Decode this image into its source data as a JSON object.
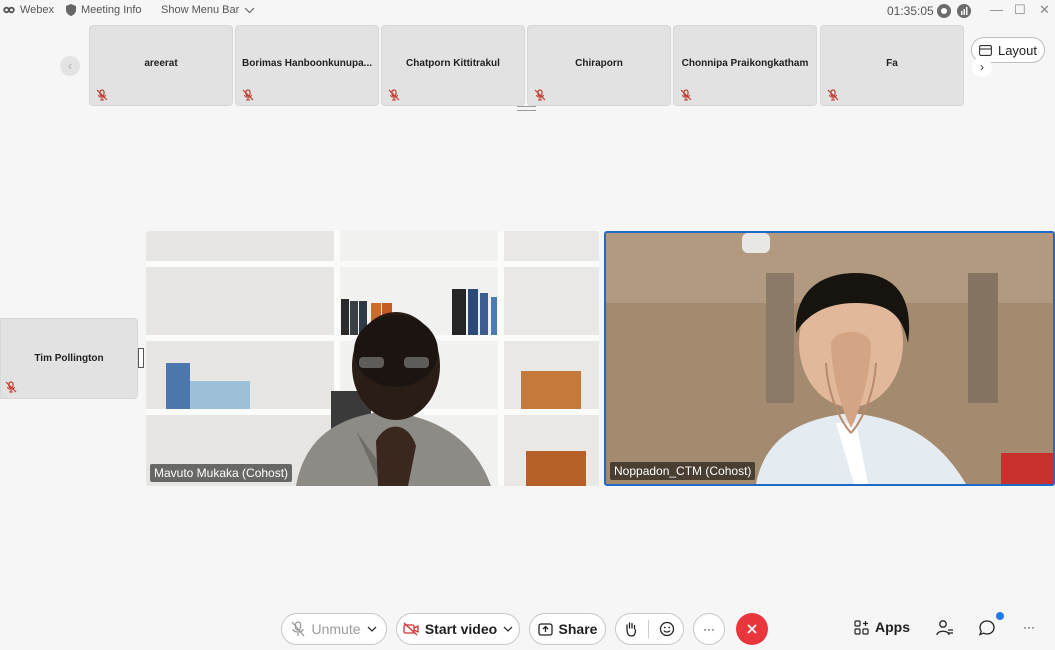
{
  "titlebar": {
    "app_name": "Webex",
    "meeting_info": "Meeting Info",
    "show_menu_bar": "Show Menu Bar",
    "elapsed_time": "01:35:05"
  },
  "participants_strip": [
    {
      "name": "areerat",
      "muted": true
    },
    {
      "name": "Borimas Hanboonkunupa...",
      "muted": true
    },
    {
      "name": "Chatporn Kittitrakul",
      "muted": true
    },
    {
      "name": "Chiraporn",
      "muted": true
    },
    {
      "name": "Chonnipa Praikongkatham",
      "muted": true
    },
    {
      "name": "Fa",
      "muted": true
    }
  ],
  "layout_button": {
    "label": "Layout",
    "icon": "layout-icon"
  },
  "side_participant": {
    "name": "Tim Pollington",
    "muted": true
  },
  "video_tiles": [
    {
      "name": "Mavuto Mukaka (Cohost)",
      "active_speaker": false
    },
    {
      "name": "Noppadon_CTM (Cohost)",
      "active_speaker": true
    }
  ],
  "controls": {
    "unmute_label": "Unmute",
    "start_video_label": "Start video",
    "share_label": "Share",
    "apps_label": "Apps",
    "more_label": "···",
    "overflow_label": "···"
  },
  "colors": {
    "accent": "#1e6bc7",
    "leave": "#e8363c",
    "muted_icon": "#c0392b",
    "notification": "#1e7ce8"
  }
}
